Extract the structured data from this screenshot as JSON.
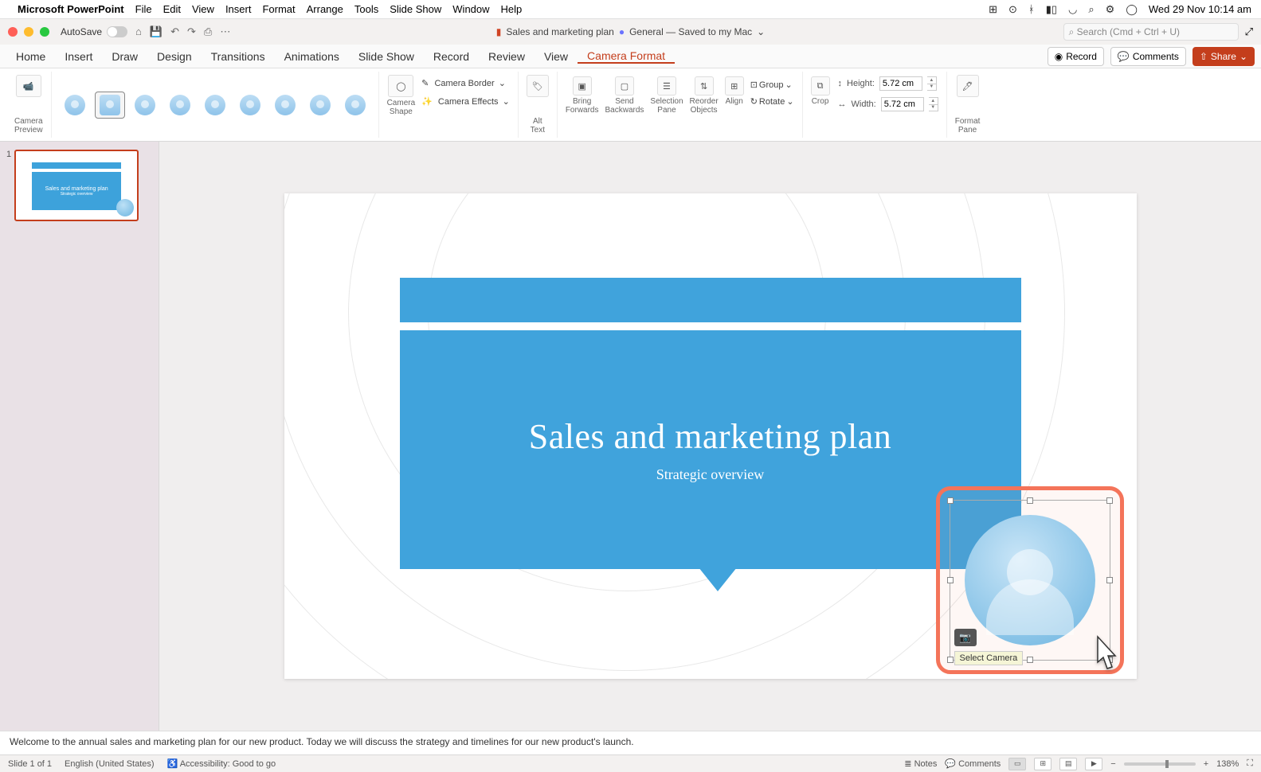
{
  "menubar": {
    "app": "Microsoft PowerPoint",
    "items": [
      "File",
      "Edit",
      "View",
      "Insert",
      "Format",
      "Arrange",
      "Tools",
      "Slide Show",
      "Window",
      "Help"
    ],
    "datetime": "Wed 29 Nov  10:14 am"
  },
  "titlebar": {
    "autosave": "AutoSave",
    "docTitle": "Sales and marketing plan",
    "channel": "General — Saved to my Mac",
    "searchPlaceholder": "Search (Cmd + Ctrl + U)"
  },
  "tabs": {
    "items": [
      "Home",
      "Insert",
      "Draw",
      "Design",
      "Transitions",
      "Animations",
      "Slide Show",
      "Record",
      "Review",
      "View",
      "Camera Format"
    ],
    "active": "Camera Format",
    "record": "Record",
    "comments": "Comments",
    "share": "Share"
  },
  "ribbon": {
    "cameraPreview": "Camera\nPreview",
    "cameraShape": "Camera\nShape",
    "cameraBorder": "Camera Border",
    "cameraEffects": "Camera Effects",
    "altText": "Alt\nText",
    "bringForwards": "Bring\nForwards",
    "sendBackwards": "Send\nBackwards",
    "selectionPane": "Selection\nPane",
    "reorderObjects": "Reorder\nObjects",
    "align": "Align",
    "group": "Group",
    "rotate": "Rotate",
    "crop": "Crop",
    "heightLabel": "Height:",
    "heightValue": "5.72 cm",
    "widthLabel": "Width:",
    "widthValue": "5.72 cm",
    "formatPane": "Format\nPane"
  },
  "thumbnails": {
    "slide1": {
      "num": "1",
      "title": "Sales and marketing plan",
      "sub": "Strategic overview"
    }
  },
  "slide": {
    "title": "Sales and marketing plan",
    "subtitle": "Strategic overview"
  },
  "cameo": {
    "tooltip": "Select Camera"
  },
  "notes": "Welcome to the annual sales and marketing plan for our new product. Today we will discuss the strategy and timelines for our new product's launch.",
  "status": {
    "slide": "Slide 1 of 1",
    "lang": "English (United States)",
    "access": "Accessibility: Good to go",
    "notesBtn": "Notes",
    "commentsBtn": "Comments",
    "zoom": "138%"
  }
}
